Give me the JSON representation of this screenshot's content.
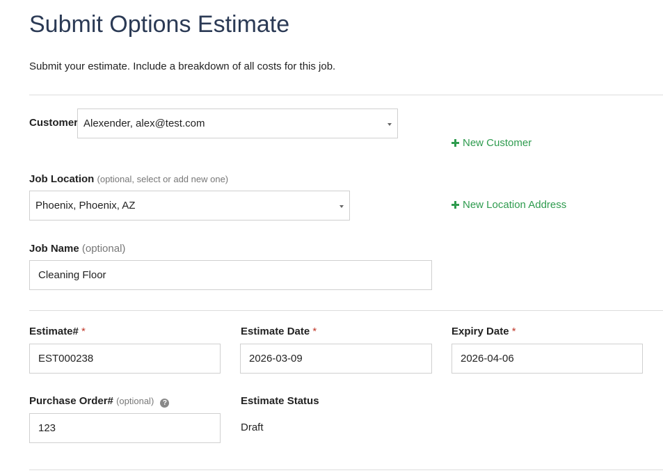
{
  "page": {
    "title": "Submit Options Estimate",
    "subtitle": "Submit your estimate. Include a breakdown of all costs for this job."
  },
  "customer": {
    "label": "Customer",
    "value": "Alexender, alex@test.com",
    "new_link": "New Customer"
  },
  "job_location": {
    "label": "Job Location",
    "hint": "(optional, select or add new one)",
    "value": "Phoenix, Phoenix, AZ",
    "new_link": "New Location Address"
  },
  "job_name": {
    "label": "Job Name",
    "hint": "(optional)",
    "value": "Cleaning Floor"
  },
  "estimate_number": {
    "label": "Estimate#",
    "required": "*",
    "value": "EST000238"
  },
  "estimate_date": {
    "label": "Estimate Date",
    "required": "*",
    "value": "2026-03-09"
  },
  "expiry_date": {
    "label": "Expiry Date",
    "required": "*",
    "value": "2026-04-06"
  },
  "purchase_order": {
    "label": "Purchase Order#",
    "hint": "(optional)",
    "value": "123",
    "help_icon": "?"
  },
  "estimate_status": {
    "label": "Estimate Status",
    "value": "Draft"
  },
  "colors": {
    "title": "#2b3a55",
    "link": "#2e9b4e",
    "required": "#c0392b",
    "border": "#cfcfcf"
  },
  "icons": {
    "new_link": "plus-icon",
    "select": "caret-down-icon",
    "help": "question-circle-icon"
  }
}
